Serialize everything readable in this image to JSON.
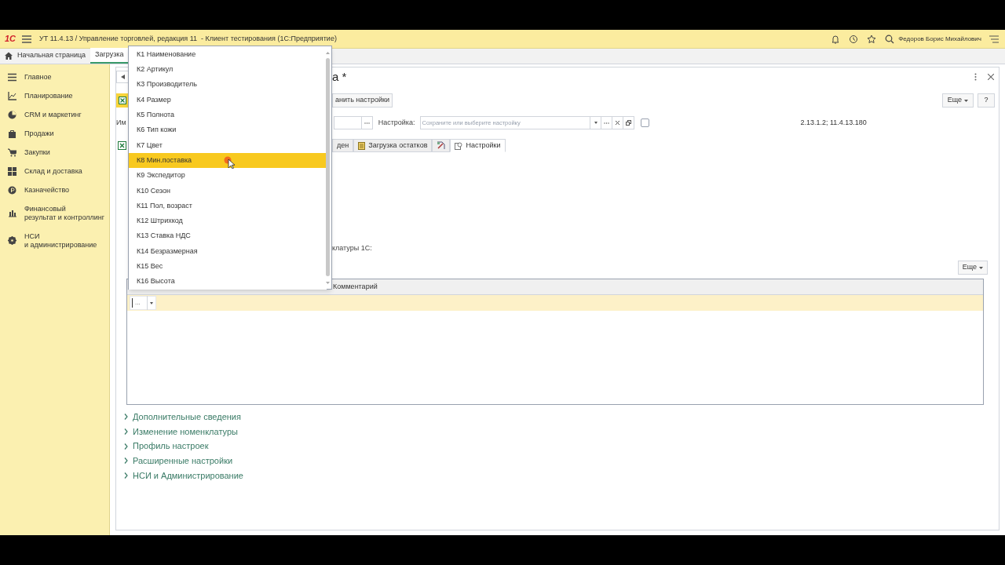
{
  "title_bar": {
    "logo": "1С",
    "title": "УТ 11.4.13 / Управление торговлей, редакция 11  - Клиент тестирования (1С:Предприятие)",
    "user": "Федоров Борис Михайлович"
  },
  "tabs": [
    {
      "label": "Начальная страница",
      "selected": false,
      "kind": "home"
    },
    {
      "label": "Загрузка",
      "selected": true,
      "kind": "doc"
    }
  ],
  "sidebar": {
    "items": [
      {
        "label": "Главное",
        "kind": "menu"
      },
      {
        "label": "Планирование",
        "kind": "plan"
      },
      {
        "label": "CRM и маркетинг",
        "kind": "pie"
      },
      {
        "label": "Продажи",
        "kind": "bag"
      },
      {
        "label": "Закупки",
        "kind": "cart"
      },
      {
        "label": "Склад и доставка",
        "kind": "grid"
      },
      {
        "label": "Казначейство",
        "kind": "coin"
      },
      {
        "label": "Финансовый\nрезультат и контроллинг",
        "kind": "bars"
      },
      {
        "label": "НСИ\nи администрирование",
        "kind": "gear"
      }
    ]
  },
  "form": {
    "title": "а *",
    "save_button": "анить настройки",
    "more_button": "Еще",
    "help_button": "?",
    "name_label": "Им",
    "setting_label": "Настройка:",
    "setting_placeholder": "Сохраните или выберите настройку",
    "use_checkbox": {
      "checked": false
    },
    "version": "2.13.1.2; 11.4.13.180",
    "tabs": [
      {
        "label": "ден",
        "kind": "text",
        "selected": false
      },
      {
        "label": "Загрузка остатков",
        "kind": "text",
        "selected": false
      },
      {
        "kind": "icon",
        "selected": false
      },
      {
        "label": "Настройки",
        "kind": "text",
        "selected": true
      }
    ],
    "hint": "клатуры 1С:",
    "table": {
      "more_button": "Еще",
      "columns": [
        "Комментарий"
      ],
      "rows": [
        {
          "value": "...",
          "selected": true
        }
      ]
    },
    "sections": [
      {
        "label": "Дополнительные сведения",
        "expanded": false
      },
      {
        "label": "Изменение номенклатуры",
        "expanded": false
      },
      {
        "label": "Профиль настроек",
        "expanded": false
      },
      {
        "label": "Расширенные настройки",
        "expanded": false
      },
      {
        "label": "НСИ и Администрирование",
        "expanded": false
      }
    ]
  },
  "dropdown": {
    "items": [
      {
        "label": "К1 Наименование",
        "selected": false
      },
      {
        "label": "К2 Артикул",
        "selected": false
      },
      {
        "label": "К3 Производитель",
        "selected": false
      },
      {
        "label": "К4 Размер",
        "selected": false
      },
      {
        "label": "К5 Полнота",
        "selected": false
      },
      {
        "label": "К6 Тип кожи",
        "selected": false
      },
      {
        "label": "К7 Цвет",
        "selected": false
      },
      {
        "label": "К8 Мин.поставка",
        "selected": true
      },
      {
        "label": "К9 Экспедитор",
        "selected": false
      },
      {
        "label": "К10 Сезон",
        "selected": false
      },
      {
        "label": "К11 Пол, возраст",
        "selected": false
      },
      {
        "label": "К12 Штрихкод",
        "selected": false
      },
      {
        "label": "К13 Ставка НДС",
        "selected": false
      },
      {
        "label": "К14 Безразмерная",
        "selected": false
      },
      {
        "label": "К15 Вес",
        "selected": false
      },
      {
        "label": "К16 Высота",
        "selected": false
      }
    ]
  }
}
